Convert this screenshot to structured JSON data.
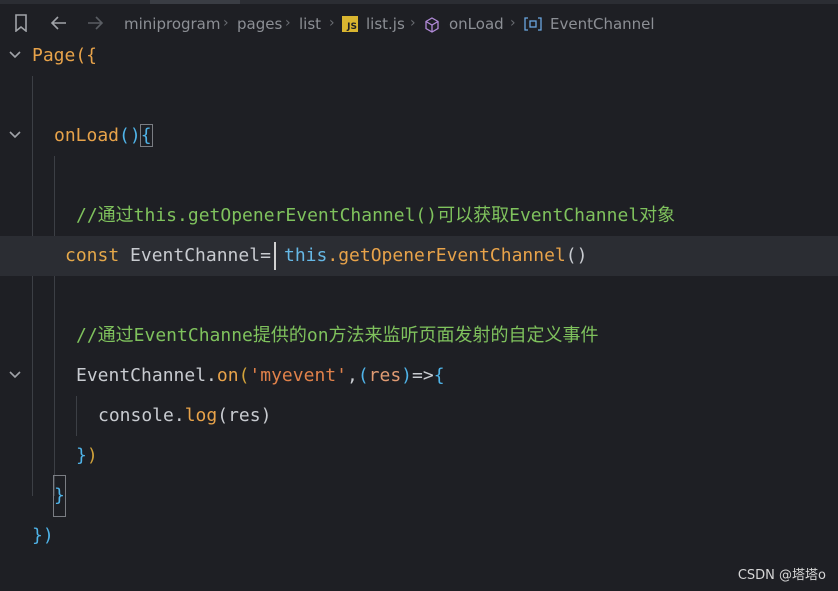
{
  "breadcrumb": {
    "segments": [
      "miniprogram",
      "pages",
      "list",
      "list.js",
      "onLoad",
      "EventChannel"
    ],
    "js_badge": "JS"
  },
  "code": {
    "line1": "Page({",
    "line3_name": "onLoad",
    "line5_comment": "//通过this.getOpenerEventChannel()可以获取EventChannel对象",
    "line6_const": "const",
    "line6_var": " EventChannel=",
    "line6_this": "this",
    "line6_method": ".getOpenerEventChannel",
    "line8_comment": "//通过EventChanne提供的on方法来监听页面发射的自定义事件",
    "line9_obj": "EventChannel.",
    "line9_on": "on",
    "line9_str": "'myevent'",
    "line9_param": "res",
    "line10_console": "console.",
    "line10_log": "log",
    "line10_arg": "res",
    "line13": "})"
  },
  "watermark": "CSDN @塔塔o",
  "colors": {
    "background": "#1e1f24",
    "active_line": "#2b2d33",
    "comment": "#7fc25d",
    "function": "#e8a34a",
    "keyword_this": "#66b8e6"
  }
}
